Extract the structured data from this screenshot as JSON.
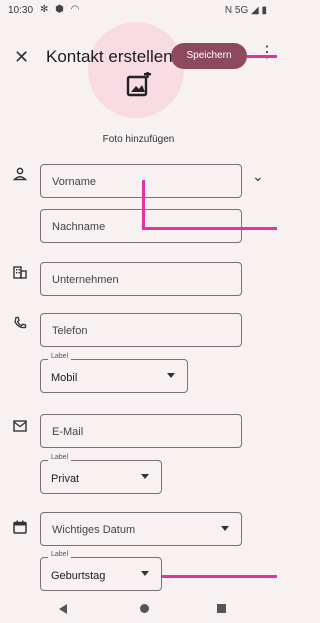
{
  "status": {
    "time": "10:30",
    "left_icons": "✻ ⬢ ◠",
    "right": "N 5G ◢ ▮"
  },
  "appbar": {
    "title": "Kontakt erstellen",
    "save_label": "Speichern"
  },
  "photo": {
    "label": "Foto hinzufügen"
  },
  "fields": {
    "first_name": "Vorname",
    "last_name": "Nachname",
    "company": "Unternehmen",
    "phone": "Telefon",
    "phone_label_caption": "Label",
    "phone_label_value": "Mobil",
    "email": "E-Mail",
    "email_label_caption": "Label",
    "email_label_value": "Privat",
    "date": "Wichtiges Datum",
    "date_label_caption": "Label",
    "date_label_value": "Geburtstag"
  },
  "accent_colors": {
    "save_button": "#8d4a5f",
    "photo_circle": "#f8dbe3",
    "annotation": "#e0359a"
  }
}
